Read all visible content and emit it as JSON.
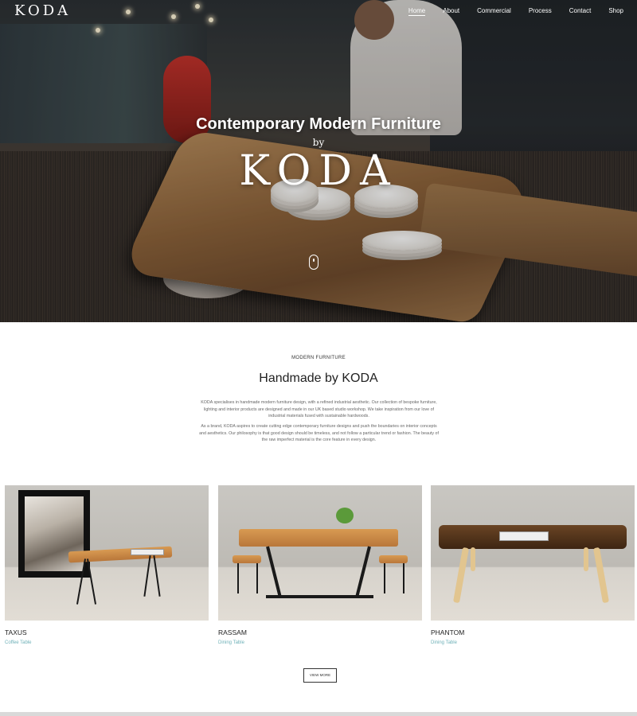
{
  "header": {
    "logo": "KODA",
    "nav": [
      {
        "label": "Home",
        "active": true
      },
      {
        "label": "About"
      },
      {
        "label": "Commercial"
      },
      {
        "label": "Process"
      },
      {
        "label": "Contact"
      },
      {
        "label": "Shop"
      }
    ]
  },
  "hero": {
    "title": "Contemporary Modern Furniture",
    "by": "by",
    "logo": "KODA"
  },
  "intro": {
    "eyebrow": "MODERN FURNITURE",
    "title": "Handmade by KODA",
    "paragraph1": "KODA specialises in handmade modern furniture design, with a refined industrial aesthetic. Our collection of bespoke furniture, lighting and interior products are designed and made in our UK based studio workshop. We take inspiration from our love of industrial materials fused with sustainable hardwoods.",
    "paragraph2": "As a brand, KODA aspires to create cutting edge contemporary furniture designs and push the boundaries on interior concepts and aesthetics. Our philosophy is that good design should be timeless, and not follow a particular trend or fashion. The beauty of the raw imperfect material is the core feature in every design."
  },
  "products": [
    {
      "name": "TAXUS",
      "type": "Coffee Table"
    },
    {
      "name": "RASSAM",
      "type": "Dining Table"
    },
    {
      "name": "PHANTOM",
      "type": "Dining Table"
    }
  ],
  "view_more": "VIEW MORE",
  "colors": {
    "accent": "#6fb1b8",
    "text": "#222222",
    "muted": "#666666"
  }
}
